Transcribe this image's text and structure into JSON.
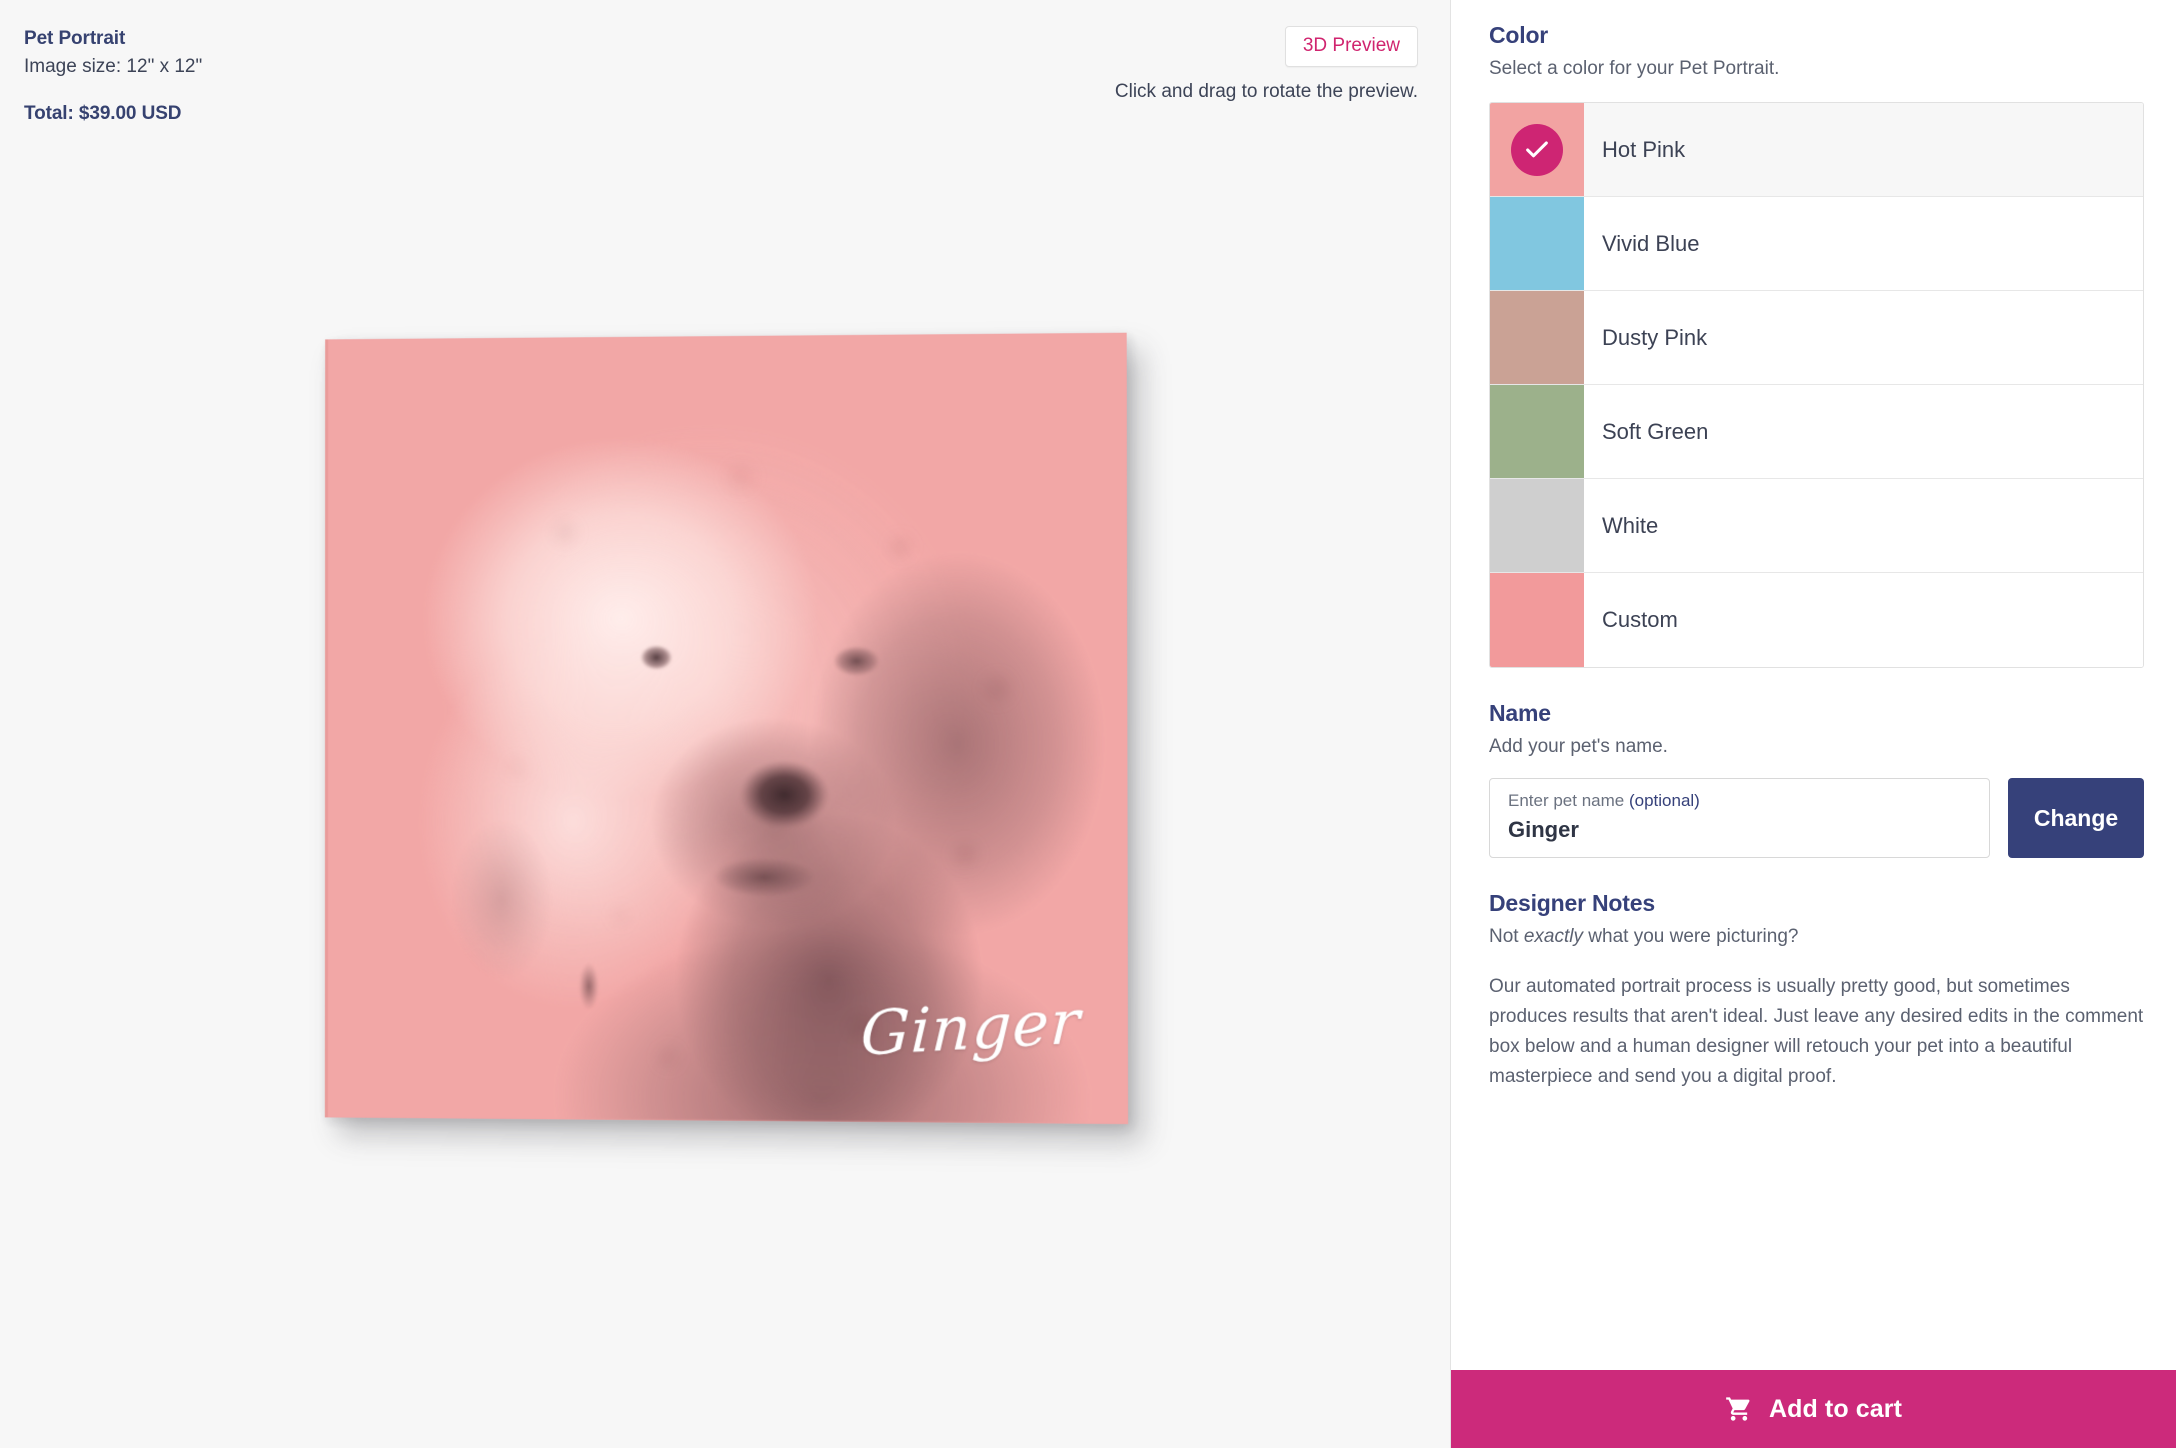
{
  "preview": {
    "product_title": "Pet Portrait",
    "image_size": "Image size: 12\" x 12\"",
    "total": "Total: $39.00 USD",
    "preview_3d_button": "3D Preview",
    "rotate_hint": "Click and drag to rotate the preview.",
    "artwork": {
      "signature": "Ginger",
      "background_color": "#f2a3a2",
      "subject": "fluffy white poodle portrait"
    }
  },
  "options": {
    "color": {
      "heading": "Color",
      "subtitle": "Select a color for your Pet Portrait.",
      "selected": "Hot Pink",
      "swatches": [
        {
          "label": "Hot Pink",
          "hex": "#f2a3a2",
          "selected": true
        },
        {
          "label": "Vivid Blue",
          "hex": "#81c7e0",
          "selected": false
        },
        {
          "label": "Dusty Pink",
          "hex": "#caa295",
          "selected": false
        },
        {
          "label": "Soft Green",
          "hex": "#9cb18b",
          "selected": false
        },
        {
          "label": "White",
          "hex": "#cfcfcf",
          "selected": false
        },
        {
          "label": "Custom",
          "hex": "#f29a9b",
          "selected": false
        }
      ],
      "check_circle_color": "#ce2573"
    },
    "name": {
      "heading": "Name",
      "subtitle": "Add your pet's name.",
      "field_label": "Enter pet name ",
      "field_label_optional": "(optional)",
      "field_value": "Ginger",
      "change_button": "Change"
    },
    "designer_notes": {
      "heading": "Designer Notes",
      "lead_prefix": "Not ",
      "lead_emphasis": "exactly",
      "lead_suffix": " what you were picturing?",
      "body": "Our automated portrait process is usually pretty good, but sometimes produces results that aren't ideal. Just leave any desired edits in the comment box below and a human designer will retouch your pet into a beautiful masterpiece and send you a digital proof."
    },
    "add_to_cart": {
      "label": "Add to cart",
      "icon": "shopping-cart-icon",
      "color": "#cc2a7b"
    }
  }
}
